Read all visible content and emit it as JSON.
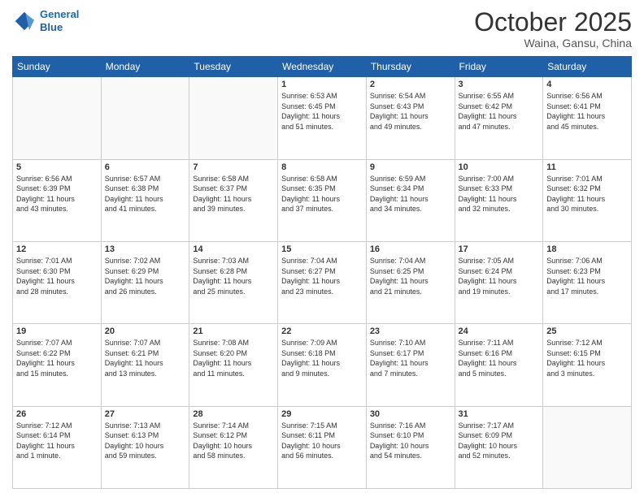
{
  "header": {
    "logo_line1": "General",
    "logo_line2": "Blue",
    "month": "October 2025",
    "location": "Waina, Gansu, China"
  },
  "weekdays": [
    "Sunday",
    "Monday",
    "Tuesday",
    "Wednesday",
    "Thursday",
    "Friday",
    "Saturday"
  ],
  "weeks": [
    [
      {
        "day": "",
        "info": ""
      },
      {
        "day": "",
        "info": ""
      },
      {
        "day": "",
        "info": ""
      },
      {
        "day": "1",
        "info": "Sunrise: 6:53 AM\nSunset: 6:45 PM\nDaylight: 11 hours\nand 51 minutes."
      },
      {
        "day": "2",
        "info": "Sunrise: 6:54 AM\nSunset: 6:43 PM\nDaylight: 11 hours\nand 49 minutes."
      },
      {
        "day": "3",
        "info": "Sunrise: 6:55 AM\nSunset: 6:42 PM\nDaylight: 11 hours\nand 47 minutes."
      },
      {
        "day": "4",
        "info": "Sunrise: 6:56 AM\nSunset: 6:41 PM\nDaylight: 11 hours\nand 45 minutes."
      }
    ],
    [
      {
        "day": "5",
        "info": "Sunrise: 6:56 AM\nSunset: 6:39 PM\nDaylight: 11 hours\nand 43 minutes."
      },
      {
        "day": "6",
        "info": "Sunrise: 6:57 AM\nSunset: 6:38 PM\nDaylight: 11 hours\nand 41 minutes."
      },
      {
        "day": "7",
        "info": "Sunrise: 6:58 AM\nSunset: 6:37 PM\nDaylight: 11 hours\nand 39 minutes."
      },
      {
        "day": "8",
        "info": "Sunrise: 6:58 AM\nSunset: 6:35 PM\nDaylight: 11 hours\nand 37 minutes."
      },
      {
        "day": "9",
        "info": "Sunrise: 6:59 AM\nSunset: 6:34 PM\nDaylight: 11 hours\nand 34 minutes."
      },
      {
        "day": "10",
        "info": "Sunrise: 7:00 AM\nSunset: 6:33 PM\nDaylight: 11 hours\nand 32 minutes."
      },
      {
        "day": "11",
        "info": "Sunrise: 7:01 AM\nSunset: 6:32 PM\nDaylight: 11 hours\nand 30 minutes."
      }
    ],
    [
      {
        "day": "12",
        "info": "Sunrise: 7:01 AM\nSunset: 6:30 PM\nDaylight: 11 hours\nand 28 minutes."
      },
      {
        "day": "13",
        "info": "Sunrise: 7:02 AM\nSunset: 6:29 PM\nDaylight: 11 hours\nand 26 minutes."
      },
      {
        "day": "14",
        "info": "Sunrise: 7:03 AM\nSunset: 6:28 PM\nDaylight: 11 hours\nand 25 minutes."
      },
      {
        "day": "15",
        "info": "Sunrise: 7:04 AM\nSunset: 6:27 PM\nDaylight: 11 hours\nand 23 minutes."
      },
      {
        "day": "16",
        "info": "Sunrise: 7:04 AM\nSunset: 6:25 PM\nDaylight: 11 hours\nand 21 minutes."
      },
      {
        "day": "17",
        "info": "Sunrise: 7:05 AM\nSunset: 6:24 PM\nDaylight: 11 hours\nand 19 minutes."
      },
      {
        "day": "18",
        "info": "Sunrise: 7:06 AM\nSunset: 6:23 PM\nDaylight: 11 hours\nand 17 minutes."
      }
    ],
    [
      {
        "day": "19",
        "info": "Sunrise: 7:07 AM\nSunset: 6:22 PM\nDaylight: 11 hours\nand 15 minutes."
      },
      {
        "day": "20",
        "info": "Sunrise: 7:07 AM\nSunset: 6:21 PM\nDaylight: 11 hours\nand 13 minutes."
      },
      {
        "day": "21",
        "info": "Sunrise: 7:08 AM\nSunset: 6:20 PM\nDaylight: 11 hours\nand 11 minutes."
      },
      {
        "day": "22",
        "info": "Sunrise: 7:09 AM\nSunset: 6:18 PM\nDaylight: 11 hours\nand 9 minutes."
      },
      {
        "day": "23",
        "info": "Sunrise: 7:10 AM\nSunset: 6:17 PM\nDaylight: 11 hours\nand 7 minutes."
      },
      {
        "day": "24",
        "info": "Sunrise: 7:11 AM\nSunset: 6:16 PM\nDaylight: 11 hours\nand 5 minutes."
      },
      {
        "day": "25",
        "info": "Sunrise: 7:12 AM\nSunset: 6:15 PM\nDaylight: 11 hours\nand 3 minutes."
      }
    ],
    [
      {
        "day": "26",
        "info": "Sunrise: 7:12 AM\nSunset: 6:14 PM\nDaylight: 11 hours\nand 1 minute."
      },
      {
        "day": "27",
        "info": "Sunrise: 7:13 AM\nSunset: 6:13 PM\nDaylight: 10 hours\nand 59 minutes."
      },
      {
        "day": "28",
        "info": "Sunrise: 7:14 AM\nSunset: 6:12 PM\nDaylight: 10 hours\nand 58 minutes."
      },
      {
        "day": "29",
        "info": "Sunrise: 7:15 AM\nSunset: 6:11 PM\nDaylight: 10 hours\nand 56 minutes."
      },
      {
        "day": "30",
        "info": "Sunrise: 7:16 AM\nSunset: 6:10 PM\nDaylight: 10 hours\nand 54 minutes."
      },
      {
        "day": "31",
        "info": "Sunrise: 7:17 AM\nSunset: 6:09 PM\nDaylight: 10 hours\nand 52 minutes."
      },
      {
        "day": "",
        "info": ""
      }
    ]
  ]
}
